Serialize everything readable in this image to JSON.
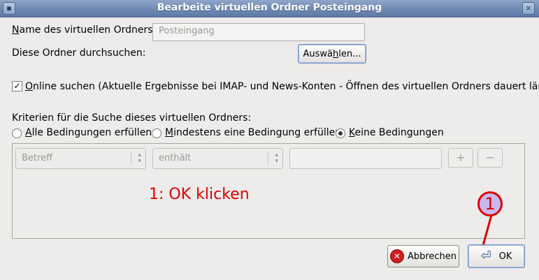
{
  "window": {
    "title": "Bearbeite virtuellen Ordner Posteingang",
    "close_glyph": "×",
    "menu_glyph": "▪"
  },
  "name_row": {
    "label_prefix": "N",
    "label_rest": "ame des virtuellen Ordners:",
    "value": "Posteingang"
  },
  "folders_row": {
    "label": "Diese Ordner durchsuchen:",
    "button_prefix": "Auswä",
    "button_u": "h",
    "button_rest": "len..."
  },
  "online": {
    "checked": true,
    "check_glyph": "✓",
    "label_prefix": "O",
    "label_rest": "nline suchen (Aktuelle Ergebnisse bei IMAP- und News-Konten - Öffnen des virtuellen Ordners dauert länger)"
  },
  "criteria": {
    "label": "Kriterien für die Suche dieses virtuellen Ordners:",
    "options": [
      {
        "u": "A",
        "rest": "lle Bedingungen erfüllen",
        "selected": false
      },
      {
        "u": "M",
        "rest": "indestens eine Bedingung erfüllen",
        "selected": false
      },
      {
        "u": "K",
        "rest": "eine Bedingungen",
        "selected": true
      }
    ]
  },
  "rule": {
    "field": "Betreff",
    "operator": "enthält",
    "value": "",
    "add": "+",
    "remove": "−",
    "arrow": "⌃⌄"
  },
  "annotation": {
    "text": "1: OK klicken",
    "step": "1",
    "color": "#e00000"
  },
  "buttons": {
    "cancel": "Abbrechen",
    "ok": "OK"
  }
}
